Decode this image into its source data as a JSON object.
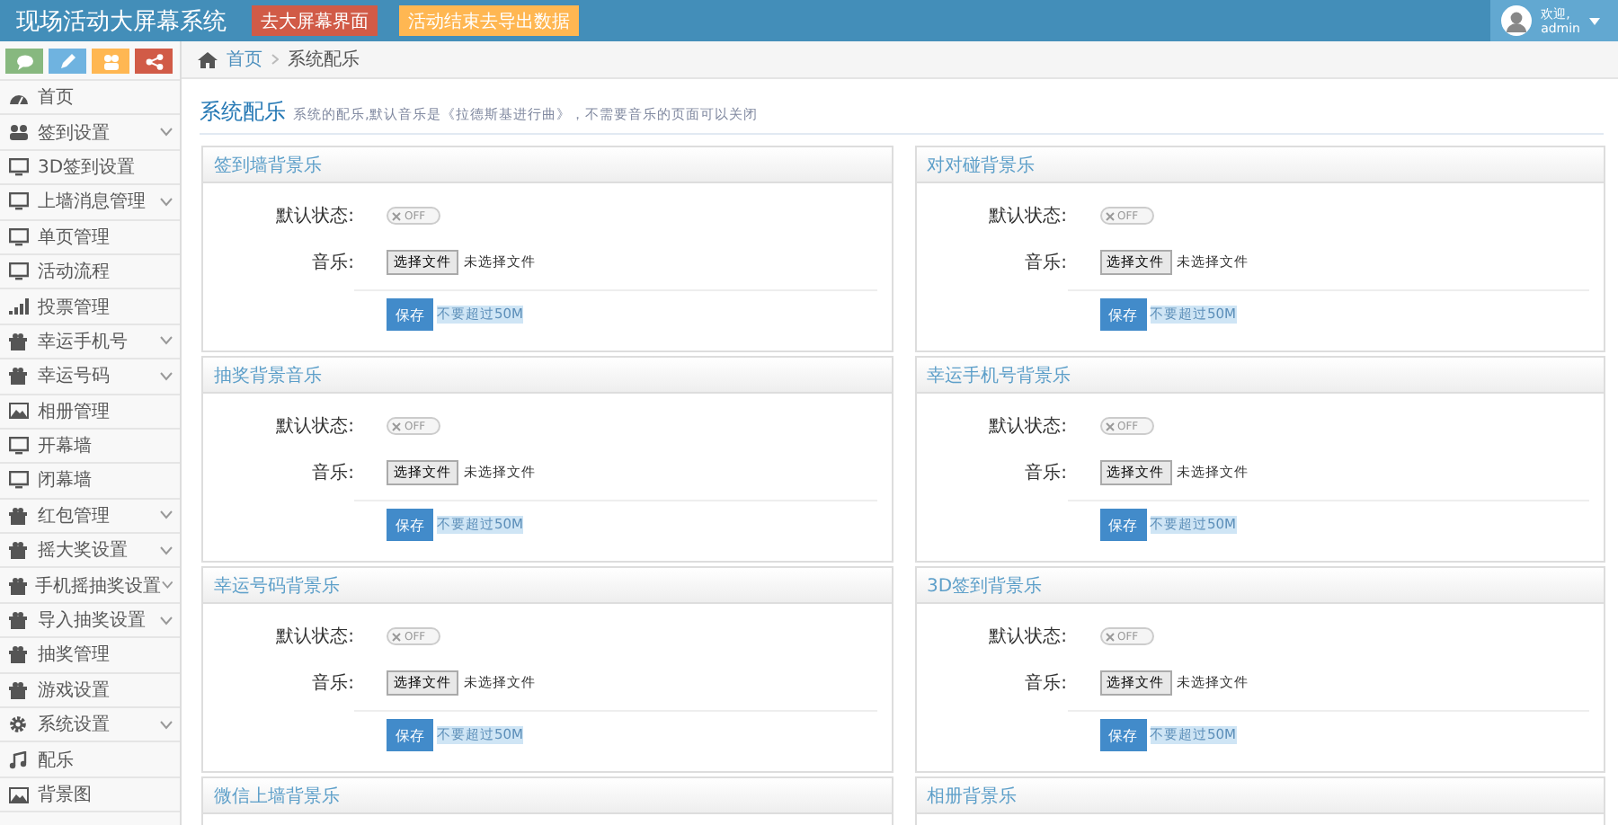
{
  "header": {
    "title": "现场活动大屏幕系统",
    "buttons": [
      {
        "label": "去大屏幕界面",
        "kind": "danger"
      },
      {
        "label": "活动结束去导出数据",
        "kind": "warning"
      }
    ],
    "user": {
      "greeting": "欢迎,",
      "name": "admin"
    }
  },
  "shortcuts": [
    {
      "color": "#87b87f"
    },
    {
      "color": "#6fb3e0"
    },
    {
      "color": "#ffb752"
    },
    {
      "color": "#d15b47"
    }
  ],
  "sidebar": {
    "items": [
      {
        "label": "首页",
        "expandable": false
      },
      {
        "label": "签到设置",
        "expandable": true
      },
      {
        "label": "3D签到设置",
        "expandable": false
      },
      {
        "label": "上墙消息管理",
        "expandable": true
      },
      {
        "label": "单页管理",
        "expandable": false
      },
      {
        "label": "活动流程",
        "expandable": false
      },
      {
        "label": "投票管理",
        "expandable": false
      },
      {
        "label": "幸运手机号",
        "expandable": true
      },
      {
        "label": "幸运号码",
        "expandable": true
      },
      {
        "label": "相册管理",
        "expandable": false
      },
      {
        "label": "开幕墙",
        "expandable": false
      },
      {
        "label": "闭幕墙",
        "expandable": false
      },
      {
        "label": "红包管理",
        "expandable": true
      },
      {
        "label": "摇大奖设置",
        "expandable": true
      },
      {
        "label": "手机摇抽奖设置",
        "expandable": true
      },
      {
        "label": "导入抽奖设置",
        "expandable": true
      },
      {
        "label": "抽奖管理",
        "expandable": false
      },
      {
        "label": "游戏设置",
        "expandable": false
      },
      {
        "label": "系统设置",
        "expandable": true
      },
      {
        "label": "配乐",
        "expandable": false
      },
      {
        "label": "背景图",
        "expandable": false
      }
    ]
  },
  "breadcrumb": [
    {
      "label": "首页",
      "link": true
    },
    {
      "label": "系统配乐",
      "link": false
    }
  ],
  "page": {
    "title": "系统配乐",
    "subtitle": "系统的配乐,默认音乐是《拉德斯基进行曲》，不需要音乐的页面可以关闭"
  },
  "panels": [
    {
      "title": "签到墙背景乐",
      "status_label": "默认状态:",
      "toggle": {
        "on": false,
        "label": "OFF"
      },
      "music_label": "音乐:",
      "file_button": "选择文件",
      "file_status": "未选择文件",
      "save": "保存",
      "hint": "不要超过50M"
    },
    {
      "title": "对对碰背景乐",
      "status_label": "默认状态:",
      "toggle": {
        "on": false,
        "label": "OFF"
      },
      "music_label": "音乐:",
      "file_button": "选择文件",
      "file_status": "未选择文件",
      "save": "保存",
      "hint": "不要超过50M"
    },
    {
      "title": "抽奖背景音乐",
      "status_label": "默认状态:",
      "toggle": {
        "on": false,
        "label": "OFF"
      },
      "music_label": "音乐:",
      "file_button": "选择文件",
      "file_status": "未选择文件",
      "save": "保存",
      "hint": "不要超过50M"
    },
    {
      "title": "幸运手机号背景乐",
      "status_label": "默认状态:",
      "toggle": {
        "on": false,
        "label": "OFF"
      },
      "music_label": "音乐:",
      "file_button": "选择文件",
      "file_status": "未选择文件",
      "save": "保存",
      "hint": "不要超过50M"
    },
    {
      "title": "幸运号码背景乐",
      "status_label": "默认状态:",
      "toggle": {
        "on": false,
        "label": "OFF"
      },
      "music_label": "音乐:",
      "file_button": "选择文件",
      "file_status": "未选择文件",
      "save": "保存",
      "hint": "不要超过50M"
    },
    {
      "title": "3D签到背景乐",
      "status_label": "默认状态:",
      "toggle": {
        "on": false,
        "label": "OFF"
      },
      "music_label": "音乐:",
      "file_button": "选择文件",
      "file_status": "未选择文件",
      "save": "保存",
      "hint": "不要超过50M"
    },
    {
      "title": "微信上墙背景乐"
    },
    {
      "title": "相册背景乐"
    }
  ]
}
